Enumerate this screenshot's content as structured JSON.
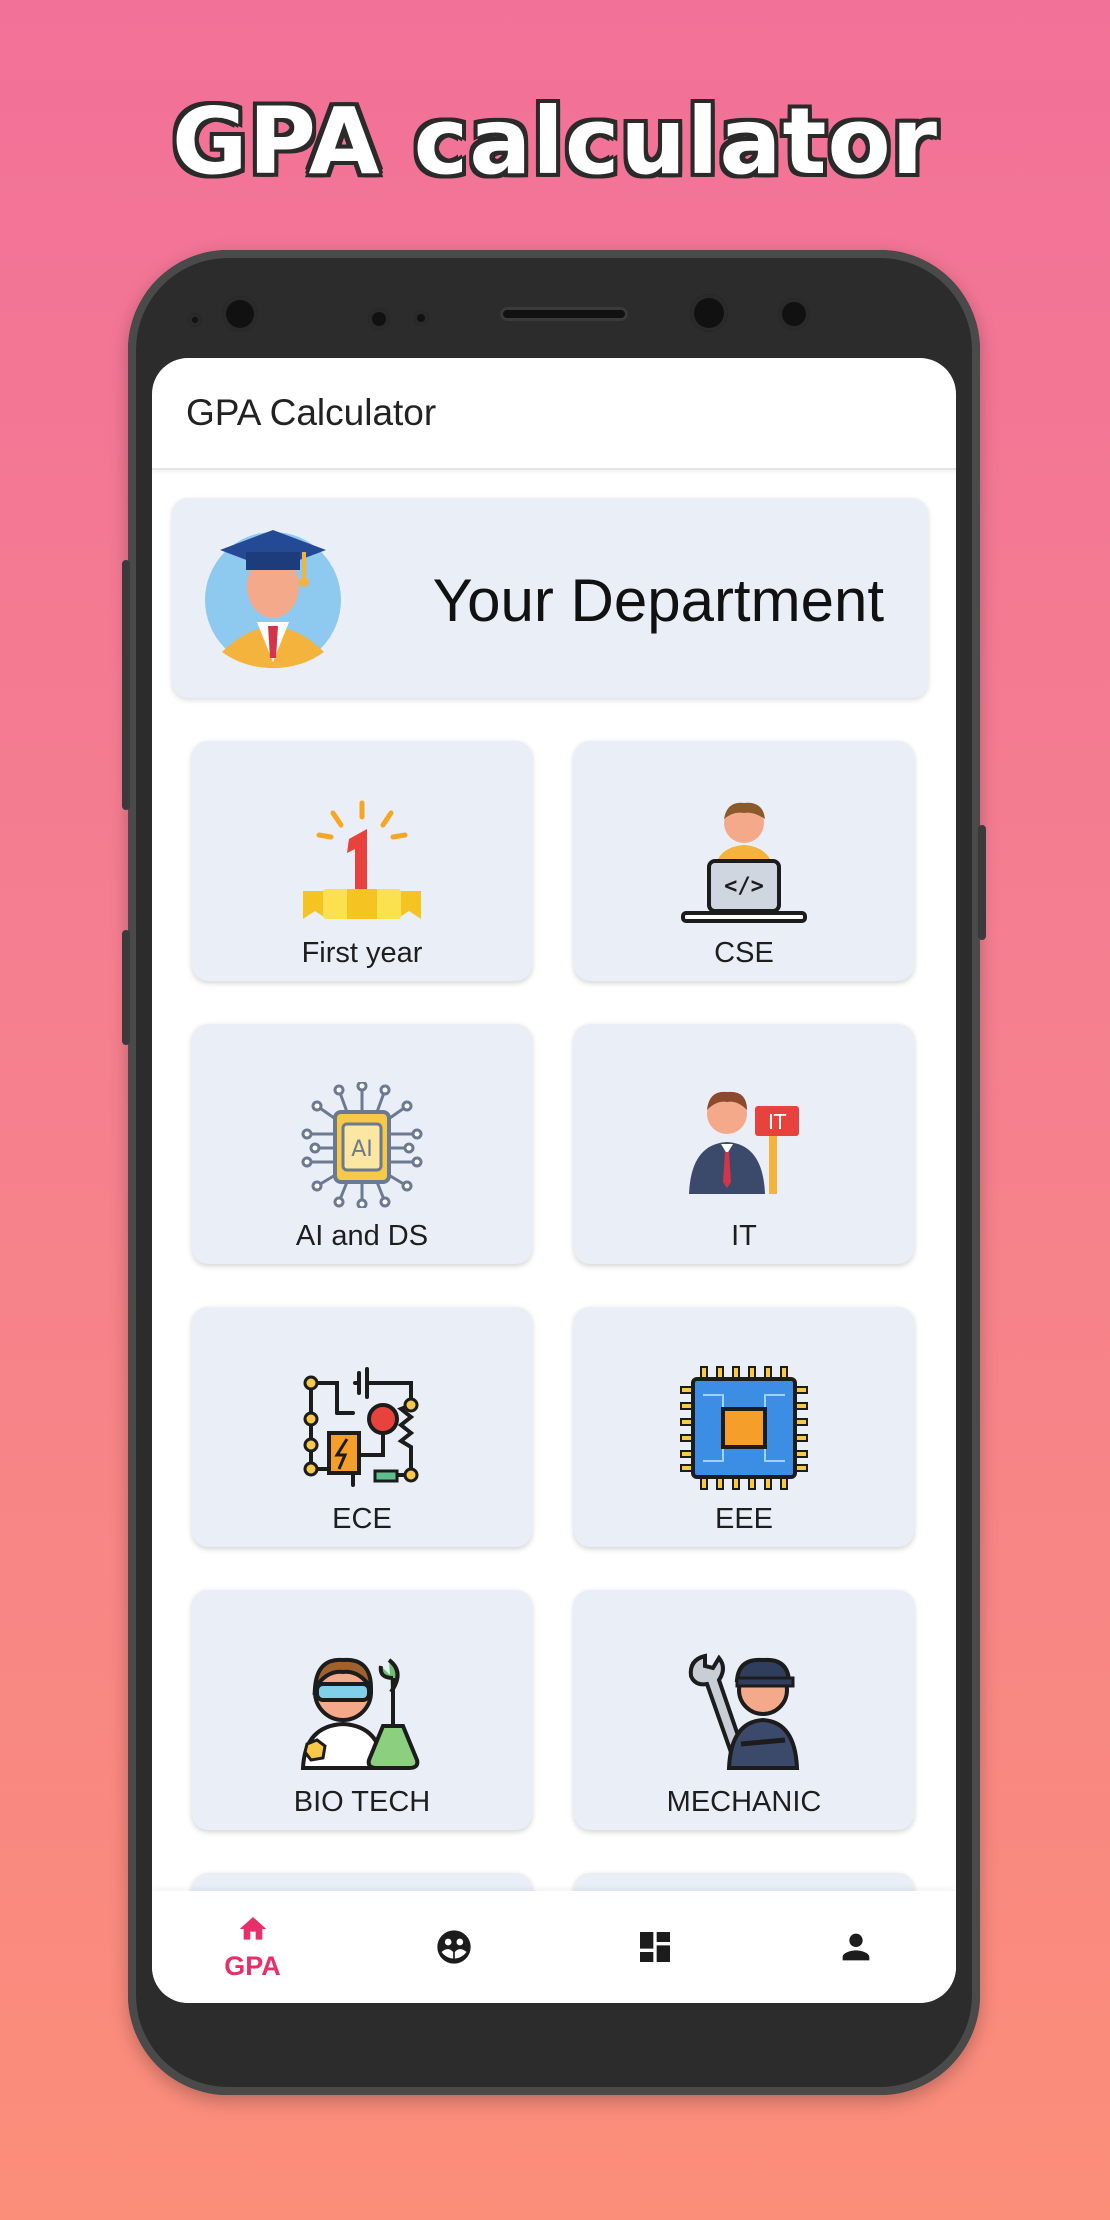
{
  "promo_title": "GPA calculator",
  "app": {
    "title": "GPA Calculator"
  },
  "banner": {
    "text": "Your Department",
    "avatar_icon": "graduate-icon"
  },
  "departments": [
    {
      "label": "First year",
      "icon": "first-place-trophy-icon"
    },
    {
      "label": "CSE",
      "icon": "programmer-laptop-icon"
    },
    {
      "label": "AI and DS",
      "icon": "ai-chip-icon"
    },
    {
      "label": "IT",
      "icon": "it-professional-icon"
    },
    {
      "label": "ECE",
      "icon": "electronic-circuit-icon"
    },
    {
      "label": "EEE",
      "icon": "microchip-board-icon"
    },
    {
      "label": "BIO TECH",
      "icon": "biotech-scientist-icon"
    },
    {
      "label": "MECHANIC",
      "icon": "mechanic-worker-icon"
    }
  ],
  "bottom_nav": {
    "items": [
      {
        "label": "GPA",
        "icon": "home-icon",
        "active": true
      },
      {
        "label": "",
        "icon": "community-icon",
        "active": false
      },
      {
        "label": "",
        "icon": "dashboard-icon",
        "active": false
      },
      {
        "label": "",
        "icon": "person-icon",
        "active": false
      }
    ]
  },
  "colors": {
    "accent": "#e6306a",
    "card_bg": "#e9eef7",
    "text": "#1e1e1e"
  }
}
